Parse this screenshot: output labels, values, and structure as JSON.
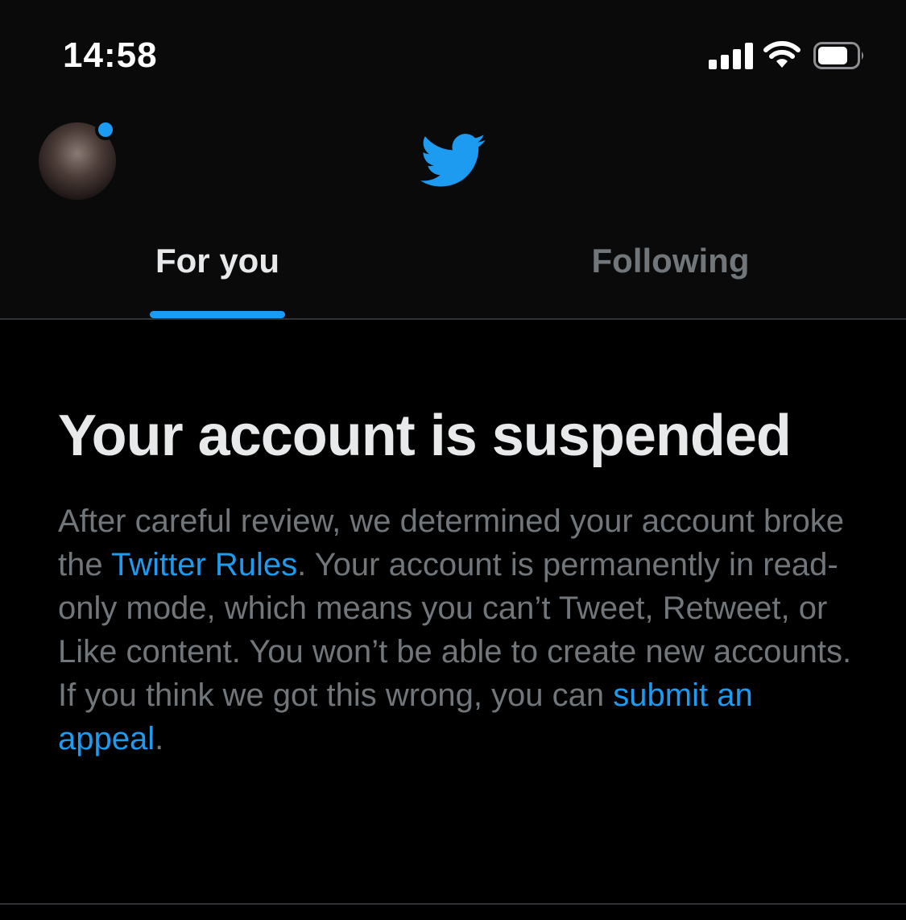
{
  "status_bar": {
    "time": "14:58",
    "icons": [
      "cellular-signal-icon",
      "wifi-icon",
      "battery-icon"
    ]
  },
  "top_bar": {
    "avatar": "profile-avatar",
    "logo": "twitter-bird-icon"
  },
  "tabs": [
    {
      "label": "For you",
      "active": true
    },
    {
      "label": "Following",
      "active": false
    }
  ],
  "notice": {
    "title": "Your account is suspended",
    "text_part1": "After careful review, we determined your account broke the ",
    "link_rules": "Twitter Rules",
    "text_part2": ". Your account is permanently in read-only mode, which means you can’t Tweet, Retweet, or Like content. You won’t be able to create new accounts. If you think we got this wrong, you can ",
    "link_appeal": "submit an appeal",
    "text_part3": "."
  },
  "colors": {
    "accent": "#1d9bf0",
    "background": "#000000",
    "header_background": "#0a0a0b",
    "primary_text": "#e7e9ea",
    "secondary_text": "#71767b",
    "divider": "#2f3336"
  }
}
